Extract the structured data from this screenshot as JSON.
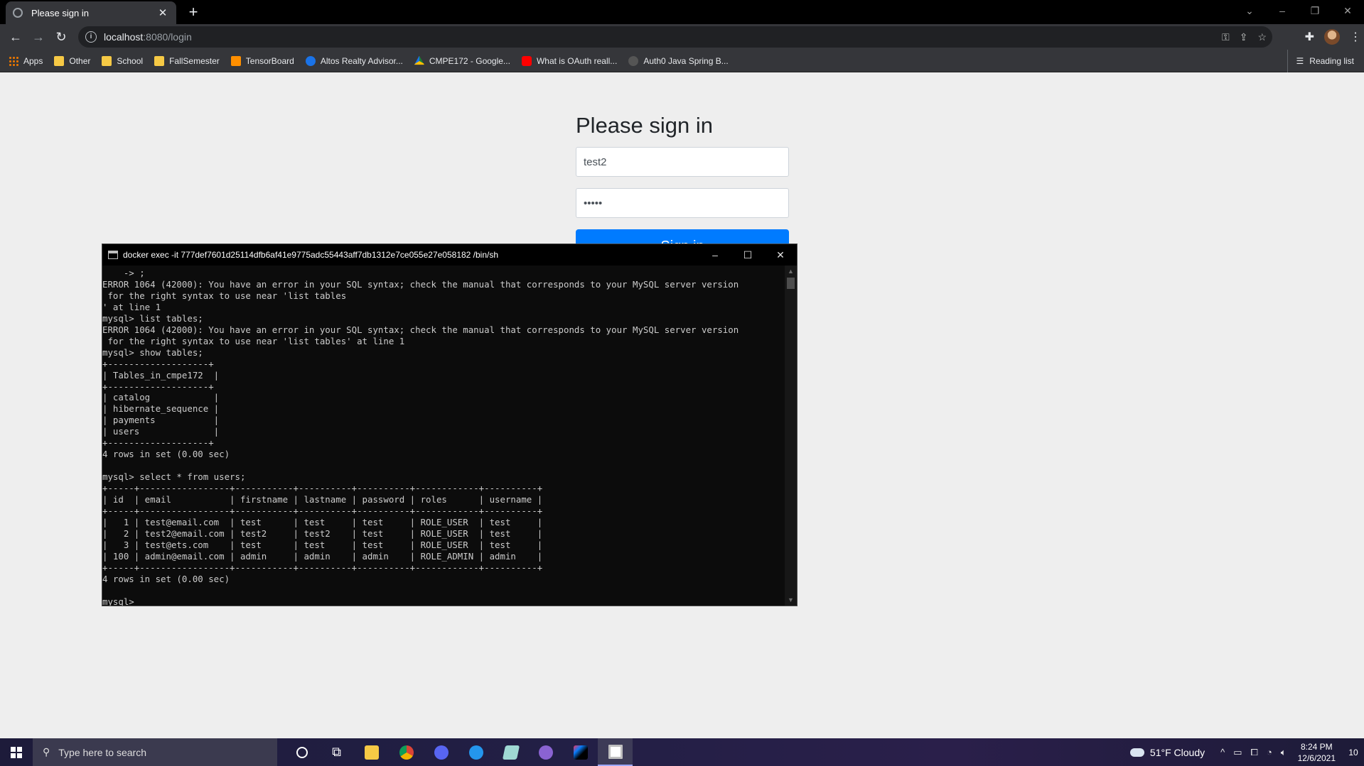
{
  "browser": {
    "tab": {
      "title": "Please sign in",
      "favicon": "globe-icon"
    },
    "new_tab": "+",
    "window_controls": {
      "tab_search": "⌄",
      "minimize": "–",
      "restore": "❐",
      "close": "✕"
    },
    "nav": {
      "back": "←",
      "forward": "→",
      "reload": "↻"
    },
    "address": {
      "host": "localhost",
      "path": ":8080/login"
    },
    "bookmarks": [
      {
        "label": "Apps",
        "icon": "apps-grid-icon"
      },
      {
        "label": "Other",
        "icon": "folder-icon"
      },
      {
        "label": "School",
        "icon": "folder-icon"
      },
      {
        "label": "FallSemester",
        "icon": "folder-icon"
      },
      {
        "label": "TensorBoard",
        "icon": "tensorboard-icon"
      },
      {
        "label": "Altos Realty Advisor...",
        "icon": "altos-icon"
      },
      {
        "label": "CMPE172 - Google...",
        "icon": "google-drive-icon"
      },
      {
        "label": "What is OAuth reall...",
        "icon": "youtube-icon"
      },
      {
        "label": "Auth0 Java Spring B...",
        "icon": "auth0-icon"
      }
    ],
    "reading_list": "Reading list"
  },
  "page": {
    "heading": "Please sign in",
    "username_value": "test2",
    "password_value": "•••••",
    "sign_in_label": "Sign in",
    "accent": "#007bff"
  },
  "console": {
    "title": "docker exec -it 777def7601d25114dfb6af41e9775adc55443aff7db1312e7ce055e27e058182 /bin/sh",
    "lines": [
      "    -> ;",
      "ERROR 1064 (42000): You have an error in your SQL syntax; check the manual that corresponds to your MySQL server version",
      " for the right syntax to use near 'list tables",
      "' at line 1",
      "mysql> list tables;",
      "ERROR 1064 (42000): You have an error in your SQL syntax; check the manual that corresponds to your MySQL server version",
      " for the right syntax to use near 'list tables' at line 1",
      "mysql> show tables;",
      "+-------------------+",
      "| Tables_in_cmpe172  |",
      "+-------------------+",
      "| catalog            |",
      "| hibernate_sequence |",
      "| payments           |",
      "| users              |",
      "+-------------------+",
      "4 rows in set (0.00 sec)",
      "",
      "mysql> select * from users;",
      "+-----+-----------------+-----------+----------+----------+------------+----------+",
      "| id  | email           | firstname | lastname | password | roles      | username |",
      "+-----+-----------------+-----------+----------+----------+------------+----------+",
      "|   1 | test@email.com  | test      | test     | test     | ROLE_USER  | test     |",
      "|   2 | test2@email.com | test2     | test2    | test     | ROLE_USER  | test     |",
      "|   3 | test@ets.com    | test      | test     | test     | ROLE_USER  | test     |",
      "| 100 | admin@email.com | admin     | admin    | admin    | ROLE_ADMIN | admin    |",
      "+-----+-----------------+-----------+----------+----------+------------+----------+",
      "4 rows in set (0.00 sec)",
      "",
      "mysql> "
    ]
  },
  "taskbar": {
    "search_placeholder": "Type here to search",
    "weather": "51°F  Cloudy",
    "time": "8:24 PM",
    "date": "12/6/2021",
    "notifications": "10",
    "apps": [
      "cortana-icon",
      "task-view-icon",
      "file-explorer-icon",
      "chrome-icon",
      "discord-icon",
      "docker-icon",
      "notepad-icon",
      "github-desktop-icon",
      "intellij-icon",
      "terminal-icon"
    ]
  }
}
